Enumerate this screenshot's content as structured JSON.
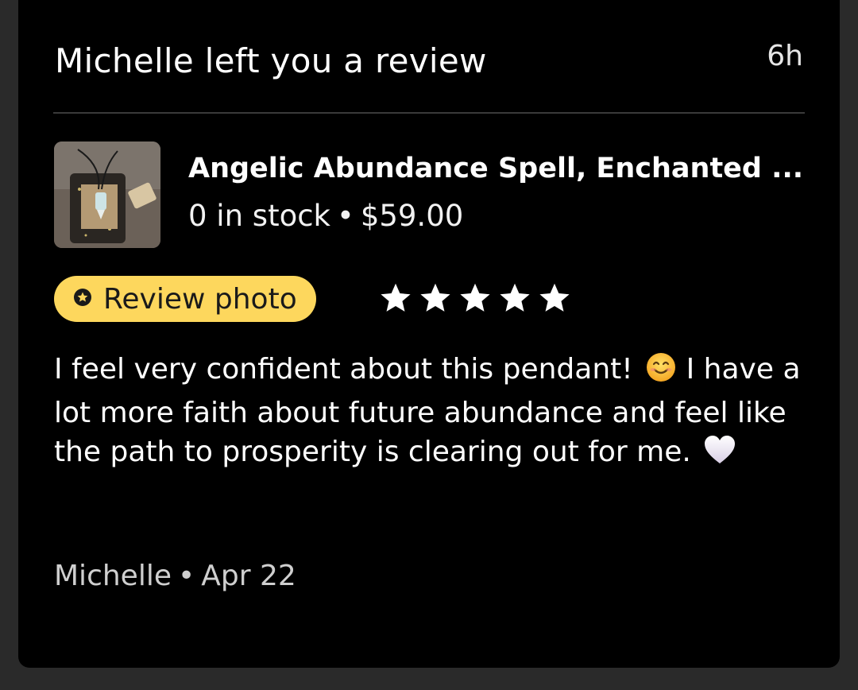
{
  "notification": {
    "title": "Michelle left you a review",
    "time": "6h"
  },
  "product": {
    "title": "Angelic Abundance Spell, Enchanted ...",
    "stock": "0 in stock",
    "separator": "•",
    "price": "$59.00",
    "thumbnail_icon": "product-photo-thumbnail"
  },
  "review": {
    "photo_button_label": "Review photo",
    "photo_button_icon": "star-badge-icon",
    "rating": 5,
    "rating_max": 5,
    "text_part1": "I feel very confident about this pendant!",
    "emoji1": "smiling-face-emoji",
    "text_part2": "I have a lot more faith about future abundance and feel like the path to prosperity is clearing out for me.",
    "emoji2": "white-heart-emoji",
    "reviewer": "Michelle",
    "separator": "•",
    "date": "Apr 22"
  },
  "colors": {
    "background": "#000000",
    "accent_yellow": "#fdd75d",
    "text_primary": "#ffffff",
    "text_secondary": "#cfcfcf"
  }
}
